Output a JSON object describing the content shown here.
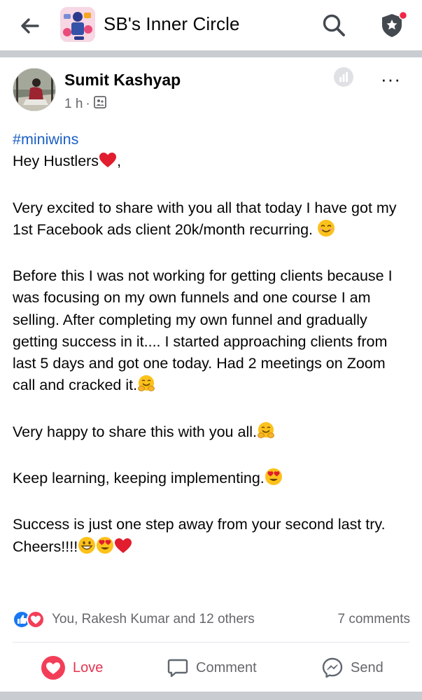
{
  "header": {
    "title": "SB's Inner Circle"
  },
  "post": {
    "author": "Sumit Kashyap",
    "time": "1 h",
    "separator": "·",
    "more_label": "···",
    "hashtag": "#miniwins",
    "greeting": "Hey Hustlers",
    "greeting_suffix": ",",
    "para1": "Very excited to share with you all that today I have got my 1st Facebook ads client 20k/month recurring.",
    "para2": "Before this I was not working for getting clients because I was focusing on my own funnels and one course I am selling. After completing my own funnel and gradually getting success in it.... I started approaching clients from last 5 days and got one today. Had 2 meetings on Zoom call and cracked it.",
    "para3": "Very happy to share this with you all.",
    "para4": "Keep learning, keeping implementing.",
    "para5": "Success is just one step away from your second last try. Cheers!!!!"
  },
  "reactions": {
    "summary": "You, Rakesh Kumar and 12 others",
    "comments": "7 comments"
  },
  "actions": {
    "love": "Love",
    "comment": "Comment",
    "send": "Send"
  },
  "colors": {
    "love_red": "#e4344f",
    "like_blue": "#1877f2",
    "hashtag_blue": "#1b5fc4",
    "notification_dot": "#f02849"
  }
}
